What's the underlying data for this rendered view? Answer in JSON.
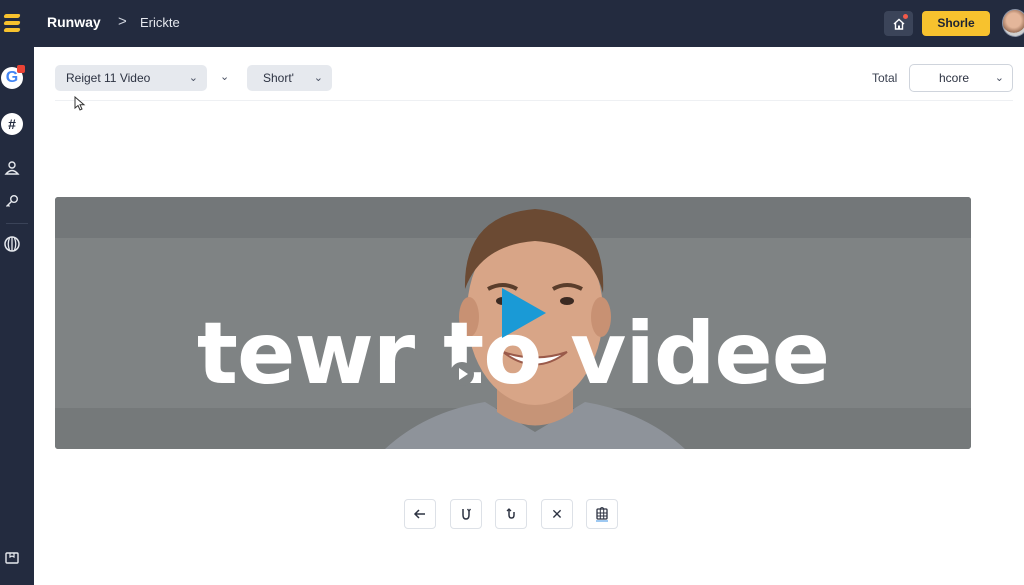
{
  "header": {
    "app_name": "Runway",
    "separator": ">",
    "page_name": "Erickte",
    "share_label": "Shorle"
  },
  "toolbar": {
    "video_select": "Reiget 11 Video",
    "short_select": "Short'",
    "total_label": "Total",
    "score_select": "hcore"
  },
  "sidebar": {
    "google_letter": "G",
    "hash_symbol": "#"
  },
  "video": {
    "title": "tewr to videe"
  },
  "controls": {
    "close": "✕"
  },
  "colors": {
    "topbar": "#232b3f",
    "accent": "#f7c22e",
    "play": "#1a9ad6"
  },
  "icons": {
    "logo": "stripes-logo-icon",
    "home": "home-icon",
    "chevron": "chevron-down-icon",
    "play": "play-icon",
    "back": "arrow-left-icon",
    "magnet": "magnet-icon",
    "close": "close-icon",
    "save": "save-icon"
  }
}
